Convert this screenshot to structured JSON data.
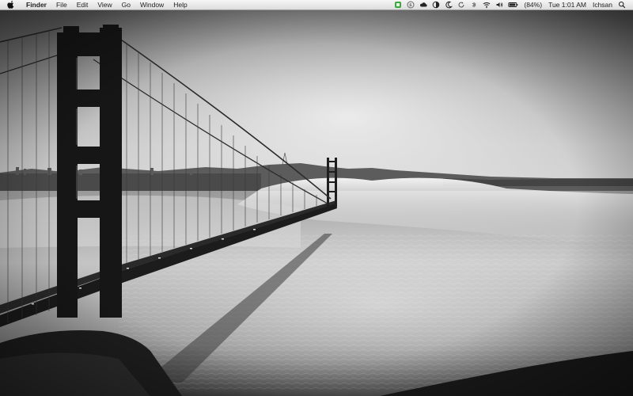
{
  "menubar": {
    "apple_icon": "apple-icon",
    "items": [
      "Finder",
      "File",
      "Edit",
      "View",
      "Go",
      "Window",
      "Help"
    ],
    "status": {
      "battery_percent": "(84%)",
      "clock": "Tue 1:01 AM",
      "user": "Ichsan"
    },
    "tray_icons": [
      "evernote-icon",
      "skype-icon",
      "cloud-icon",
      "half-circle-icon",
      "moon-icon",
      "sync-icon",
      "bluetooth-icon",
      "wifi-icon",
      "volume-icon",
      "battery-icon",
      "spotlight-icon"
    ]
  },
  "desktop": {
    "wallpaper": "golden-gate-bridge-fog-bw"
  },
  "colors": {
    "menubar_top": "#f6f6f6",
    "menubar_bottom": "#dcdcdc",
    "evernote_green": "#3ca83c"
  }
}
